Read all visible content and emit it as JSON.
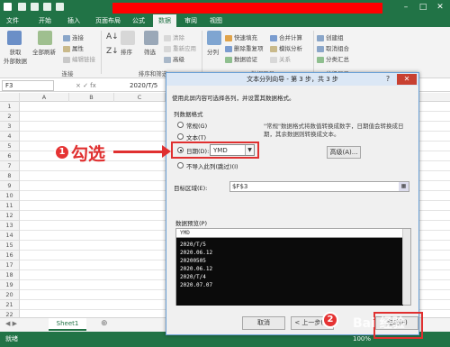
{
  "menubar": {
    "tabs": [
      "文件",
      "开始",
      "插入",
      "页面布局",
      "公式",
      "数据",
      "审阅",
      "视图"
    ],
    "active": "数据"
  },
  "ribbon": {
    "get_external": "获取\n外部数据",
    "refresh_all": "全部刷新",
    "connections": "连接",
    "properties": "属性",
    "edit_links": "编辑链接",
    "group_connections": "连接",
    "sort": "排序",
    "filter": "筛选",
    "clear": "清除",
    "reapply": "重新应用",
    "advanced": "高级",
    "group_sort_filter": "排序和筛选",
    "split": "分列",
    "flash_fill": "快速填充",
    "remove_dup": "删除重复项",
    "validation": "数据验证",
    "consolidate": "合并计算",
    "whatif": "模拟分析",
    "relations": "关系",
    "group_tools": "数据工具",
    "group": "创建组",
    "ungroup": "取消组合",
    "subtotal": "分类汇总",
    "group_outline": "分级显示"
  },
  "formula": {
    "namebox": "F3",
    "fx": "× ✓ fx",
    "value": "2020/T/5"
  },
  "columns": [
    "A",
    "B",
    "C"
  ],
  "rows": [
    "1",
    "2",
    "3",
    "4",
    "5",
    "6",
    "7",
    "8",
    "9",
    "10",
    "11",
    "12",
    "13",
    "14",
    "15",
    "16",
    "17",
    "18",
    "19",
    "20",
    "21",
    "22"
  ],
  "sheet": {
    "tab": "Sheet1",
    "add": "⊕"
  },
  "status": {
    "left": "就绪",
    "zoom": "100%"
  },
  "dialog": {
    "title": "文本分列向导 - 第 3 步，共 3 步",
    "help": "?",
    "close": "✕",
    "intro": "使用此屏内容可选择各列，并设置其数据格式。",
    "section_format": "列数据格式",
    "opt_general": "常规(G)",
    "opt_text": "文本(T)",
    "opt_date": "日期(D):",
    "date_value": "YMD",
    "opt_skip": "不导入此列(跳过)(I)",
    "note_line1": "\"常规\"数据格式将数值转换成数字，日期值会转换成日",
    "note_line2": "期，其余数据则转换成文本。",
    "advanced_btn": "高级(A)...",
    "dest_label": "目标区域(E):",
    "dest_value": "$F$3",
    "preview_label": "数据预览(P)",
    "preview_header": "YMD",
    "preview_rows": [
      "2020/T/5",
      "2020.06.12",
      "20200505",
      "2020.06.12",
      "2020/T/4",
      "2020.07.07"
    ],
    "cancel_btn": "取消",
    "back_btn": "< 上一步(B)",
    "finish_btn": "完成(F)"
  },
  "annotations": {
    "badge1": "1",
    "label1": "勾选",
    "badge2": "2",
    "watermark": "Bai 经验"
  },
  "colors": {
    "excel_green": "#217346",
    "annotation_red": "#e03030"
  }
}
